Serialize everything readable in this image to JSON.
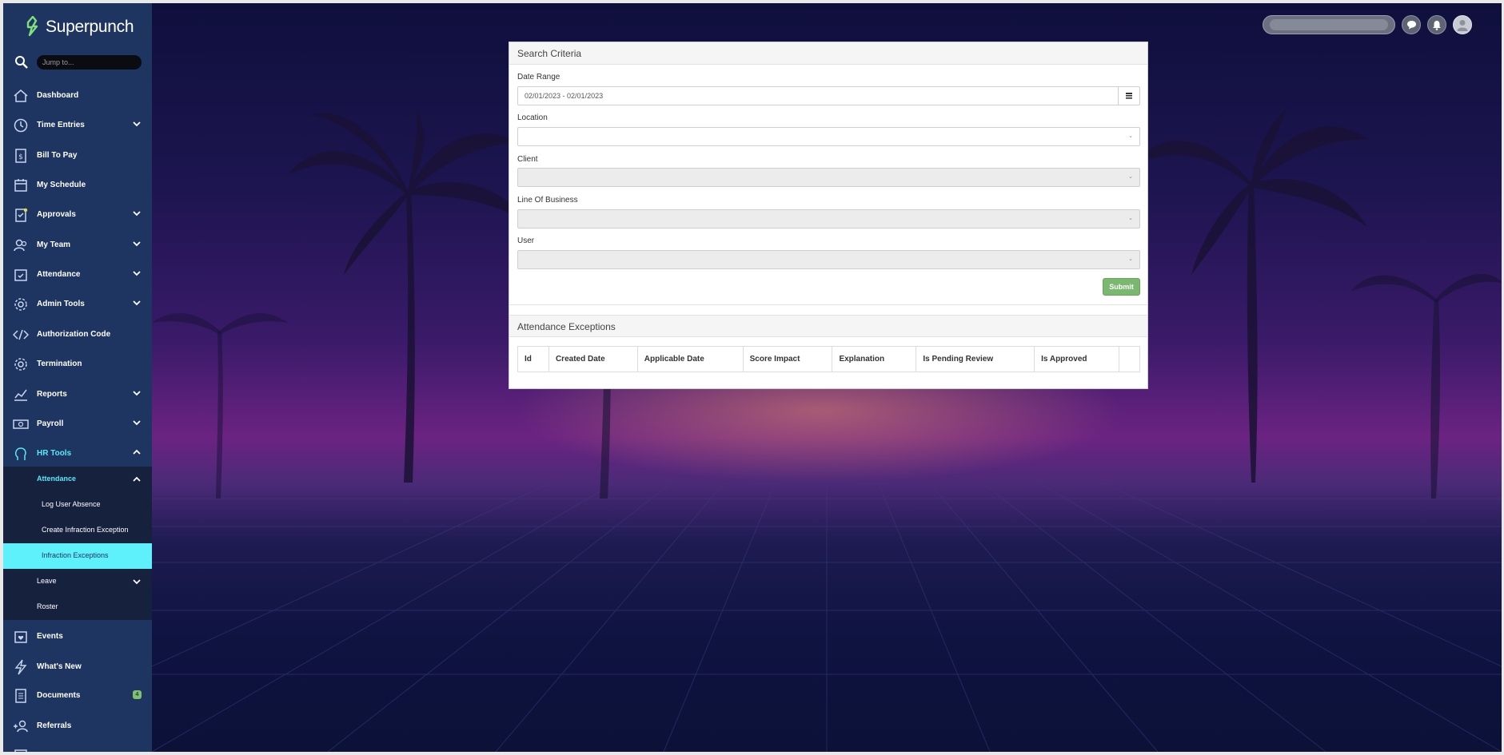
{
  "brand": {
    "name": "Superpunch"
  },
  "sidebar": {
    "jump_placeholder": "Jump to...",
    "items": [
      {
        "label": "Dashboard",
        "icon": "home-icon"
      },
      {
        "label": "Time Entries",
        "icon": "clock-icon"
      },
      {
        "label": "Bill To Pay",
        "icon": "bill-icon"
      },
      {
        "label": "My Schedule",
        "icon": "calendar-icon"
      },
      {
        "label": "Approvals",
        "icon": "clipboard-check-icon"
      },
      {
        "label": "My Team",
        "icon": "team-icon"
      },
      {
        "label": "Attendance",
        "icon": "calendar-check-icon"
      },
      {
        "label": "Admin Tools",
        "icon": "gear-icon"
      },
      {
        "label": "Authorization Code",
        "icon": "code-icon"
      },
      {
        "label": "Termination",
        "icon": "gear-icon"
      },
      {
        "label": "Reports",
        "icon": "chart-icon"
      },
      {
        "label": "Payroll",
        "icon": "money-icon"
      },
      {
        "label": "HR Tools",
        "icon": "head-icon"
      },
      {
        "label": "Events",
        "icon": "calendar-heart-icon"
      },
      {
        "label": "What's New",
        "icon": "lightning-icon"
      },
      {
        "label": "Documents",
        "icon": "document-icon",
        "badge": "4"
      },
      {
        "label": "Referrals",
        "icon": "add-user-icon"
      }
    ],
    "hr_tools_sub": {
      "attendance_label": "Attendance",
      "log_user_absence": "Log User Absence",
      "create_infraction_exception": "Create Infraction Exception",
      "infraction_exceptions": "Infraction Exceptions",
      "leave": "Leave",
      "roster": "Roster"
    }
  },
  "search_criteria": {
    "title": "Search Criteria",
    "date_range_label": "Date Range",
    "date_range_value": "02/01/2023 - 02/01/2023",
    "location_label": "Location",
    "client_label": "Client",
    "line_of_business_label": "Line Of Business",
    "user_label": "User",
    "submit_label": "Submit"
  },
  "attendance_exceptions": {
    "title": "Attendance Exceptions",
    "columns": [
      "Id",
      "Created Date",
      "Applicable Date",
      "Score Impact",
      "Explanation",
      "Is Pending Review",
      "Is Approved",
      ""
    ]
  },
  "colors": {
    "sidebar_bg": "#1e3561",
    "accent": "#58e9f7",
    "submit": "#7bb86f"
  }
}
